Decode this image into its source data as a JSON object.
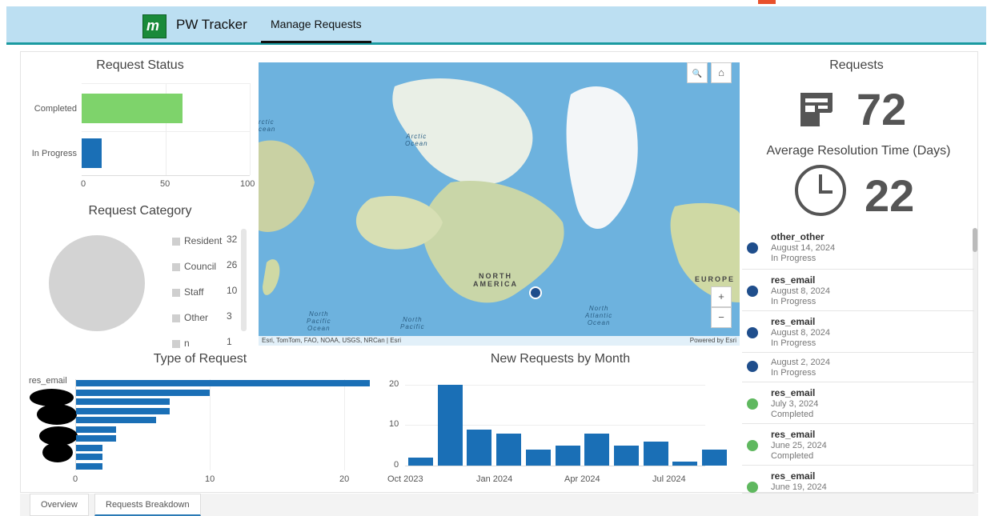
{
  "header": {
    "app_title": "PW Tracker",
    "tab_manage": "Manage Requests"
  },
  "request_status": {
    "title": "Request Status",
    "axis_ticks": [
      "0",
      "50",
      "100"
    ]
  },
  "request_category": {
    "title": "Request Category",
    "legend": [
      {
        "label": "Resident",
        "value": "32"
      },
      {
        "label": "Council",
        "value": "26"
      },
      {
        "label": "Staff",
        "value": "10"
      },
      {
        "label": "Other",
        "value": "3"
      },
      {
        "label": "n",
        "value": "1"
      }
    ]
  },
  "map": {
    "labels": {
      "arctic_ocean_left": "rctic\ncean",
      "arctic_ocean": "Arctic\nOcean",
      "north_america": "NORTH\nAMERICA",
      "europe": "EUROPE",
      "north_pacific_left": "North\nPacific\nOcean",
      "north_pacific": "North\nPacific",
      "north_atlantic": "North\nAtlantic\nOcean"
    },
    "attribution": "Esri, TomTom, FAO, NOAA, USGS, NRCan | Esri",
    "powered_by": "Powered by Esri",
    "zoom_in": "+",
    "zoom_out": "−",
    "search_glyph": "🔍",
    "home_glyph": "⌂"
  },
  "requests_panel": {
    "title": "Requests",
    "count": "72",
    "avg_title": "Average Resolution Time (Days)",
    "avg_value": "22"
  },
  "request_list": [
    {
      "title": "other_other",
      "date": "August 14, 2024",
      "status": "In Progress",
      "color": "#1f4e8c"
    },
    {
      "title": "res_email",
      "date": "August 8, 2024",
      "status": "In Progress",
      "color": "#1f4e8c"
    },
    {
      "title": "res_email",
      "date": "August 8, 2024",
      "status": "In Progress",
      "color": "#1f4e8c"
    },
    {
      "title": "",
      "date": "August 2, 2024",
      "status": "In Progress",
      "color": "#1f4e8c"
    },
    {
      "title": "res_email",
      "date": "July 3, 2024",
      "status": "Completed",
      "color": "#5fb85f"
    },
    {
      "title": "res_email",
      "date": "June 25, 2024",
      "status": "Completed",
      "color": "#5fb85f"
    },
    {
      "title": "res_email",
      "date": "June 19, 2024",
      "status": "",
      "color": "#5fb85f"
    }
  ],
  "type_of_request": {
    "title": "Type of Request",
    "first_label": "res_email",
    "axis_ticks": [
      "0",
      "10",
      "20"
    ]
  },
  "new_requests": {
    "title": "New Requests by Month",
    "y_ticks": [
      "0",
      "10",
      "20"
    ],
    "x_ticks": [
      "Oct 2023",
      "Jan 2024",
      "Apr 2024",
      "Jul 2024"
    ]
  },
  "bottom_tabs": {
    "overview": "Overview",
    "breakdown": "Requests Breakdown"
  },
  "chart_data": [
    {
      "type": "bar",
      "title": "Request Status",
      "orientation": "horizontal",
      "categories": [
        "Completed",
        "In Progress"
      ],
      "values": [
        60,
        12
      ],
      "colors": [
        "#7ed36b",
        "#1a6fb6"
      ],
      "xlim": [
        0,
        100
      ]
    },
    {
      "type": "pie",
      "title": "Request Category",
      "categories": [
        "Resident",
        "Council",
        "Staff",
        "Other",
        "n"
      ],
      "values": [
        32,
        26,
        10,
        3,
        1
      ]
    },
    {
      "type": "bar",
      "title": "Type of Request",
      "orientation": "horizontal",
      "categories": [
        "res_email",
        "",
        "",
        "",
        "",
        "",
        "",
        "",
        "",
        ""
      ],
      "values": [
        22,
        10,
        7,
        7,
        6,
        3,
        3,
        2,
        2,
        2
      ],
      "xlim": [
        0,
        22
      ]
    },
    {
      "type": "bar",
      "title": "New Requests by Month",
      "categories": [
        "Oct 2023",
        "Nov 2023",
        "Dec 2023",
        "Jan 2024",
        "Feb 2024",
        "Mar 2024",
        "Apr 2024",
        "May 2024",
        "Jun 2024",
        "Jul 2024",
        "Aug 2024"
      ],
      "values": [
        2,
        20,
        9,
        8,
        4,
        5,
        8,
        5,
        6,
        1,
        4
      ],
      "ylim": [
        0,
        20
      ]
    }
  ]
}
